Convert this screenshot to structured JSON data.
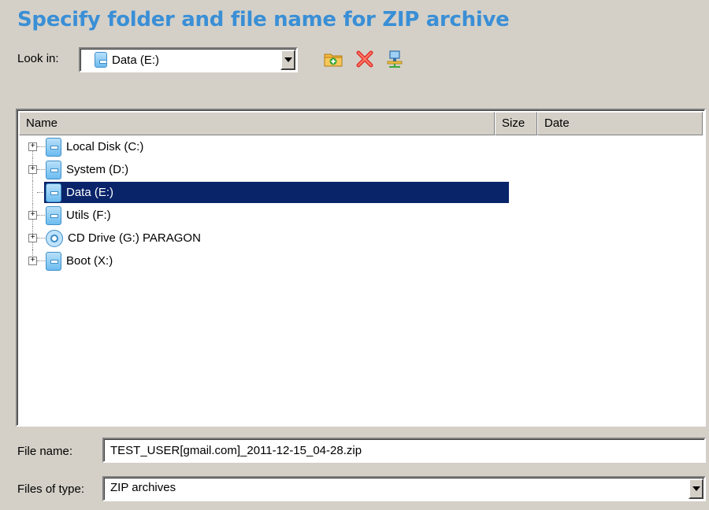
{
  "dialog": {
    "title": "Specify folder and file name for ZIP archive"
  },
  "look_in": {
    "label": "Look in:",
    "value": "Data (E:)"
  },
  "toolbar": {
    "icons": [
      "new-folder-icon",
      "delete-icon",
      "network-icon"
    ]
  },
  "file_list": {
    "columns": [
      "Name",
      "Size",
      "Date"
    ],
    "items": [
      {
        "label": "Local Disk (C:)",
        "icon": "drive-icon",
        "expandable": true,
        "selected": false
      },
      {
        "label": "System (D:)",
        "icon": "drive-icon",
        "expandable": true,
        "selected": false
      },
      {
        "label": "Data (E:)",
        "icon": "drive-icon",
        "expandable": false,
        "selected": true
      },
      {
        "label": "Utils (F:)",
        "icon": "drive-icon",
        "expandable": true,
        "selected": false
      },
      {
        "label": "CD Drive (G:) PARAGON",
        "icon": "cd-icon",
        "expandable": true,
        "selected": false
      },
      {
        "label": "Boot (X:)",
        "icon": "drive-icon",
        "expandable": true,
        "selected": false
      }
    ]
  },
  "file_name": {
    "label": "File name:",
    "value": "TEST_USER[gmail.com]_2011-12-15_04-28.zip"
  },
  "file_type": {
    "label": "Files of type:",
    "value": "ZIP archives"
  },
  "colors": {
    "title": "#3a8fd6",
    "selection": "#0a246a",
    "background": "#d4d0c8"
  }
}
